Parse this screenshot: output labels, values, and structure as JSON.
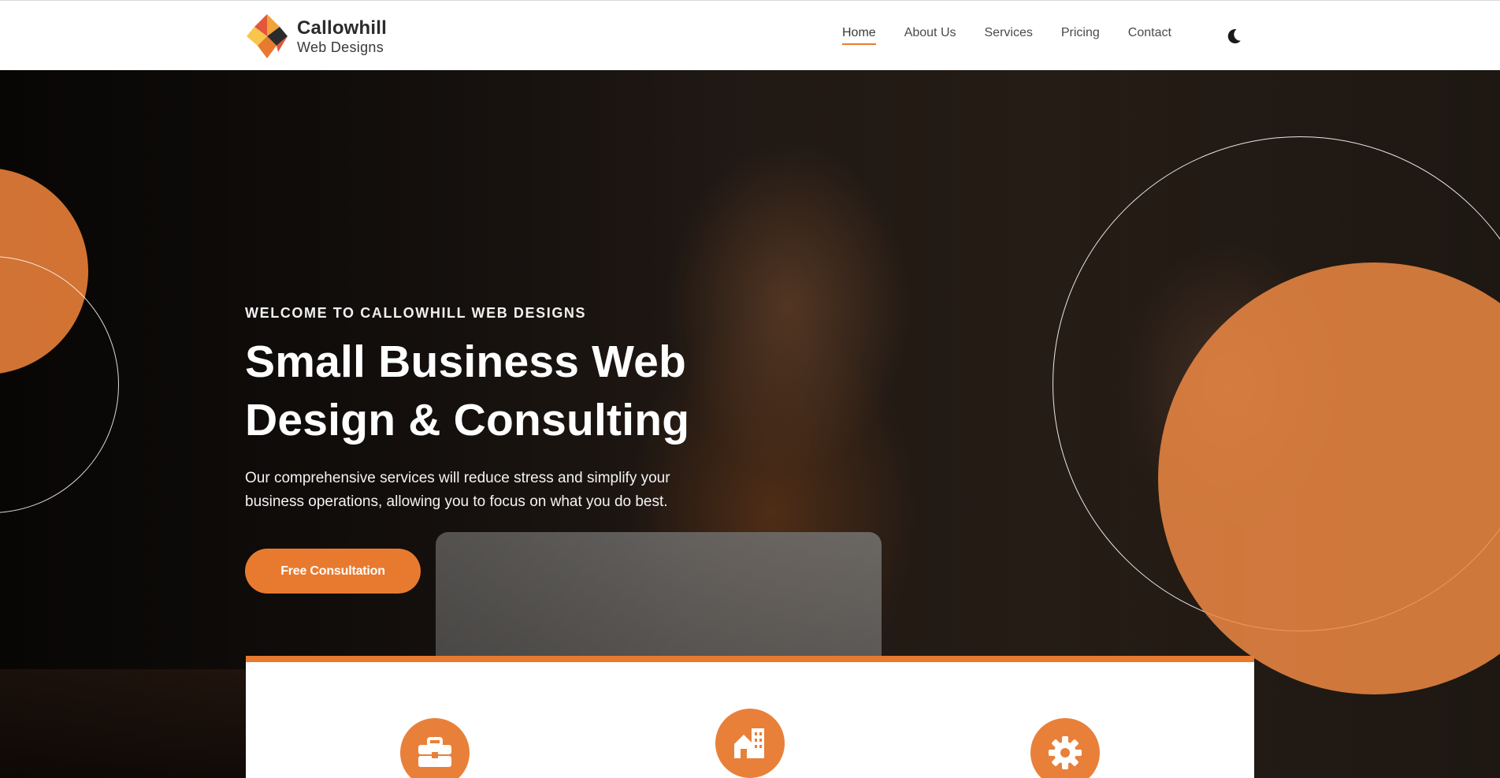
{
  "brand": {
    "name": "Callowhill",
    "subtitle": "Web Designs",
    "logo_colors": [
      "#f2a23a",
      "#e3573b",
      "#2b2b2b",
      "#f7c64a"
    ]
  },
  "nav": {
    "items": [
      {
        "label": "Home",
        "active": true
      },
      {
        "label": "About Us",
        "active": false
      },
      {
        "label": "Services",
        "active": false
      },
      {
        "label": "Pricing",
        "active": false
      },
      {
        "label": "Contact",
        "active": false
      }
    ],
    "theme_toggle_icon": "moon-icon"
  },
  "hero": {
    "eyebrow": "WELCOME TO CALLOWHILL WEB DESIGNS",
    "headline_line1": "Small Business Web",
    "headline_line2": "Design & Consulting",
    "lead": "Our comprehensive services will reduce stress and simplify your business operations, allowing you to focus on what you do best.",
    "cta_label": "Free Consultation"
  },
  "services": {
    "icons": [
      "briefcase-icon",
      "building-home-icon",
      "gear-icon"
    ]
  },
  "colors": {
    "accent": "#e87a30",
    "accent_light": "#ee8a44",
    "text_dark": "#2d2d2d",
    "hero_text": "#ffffff"
  }
}
